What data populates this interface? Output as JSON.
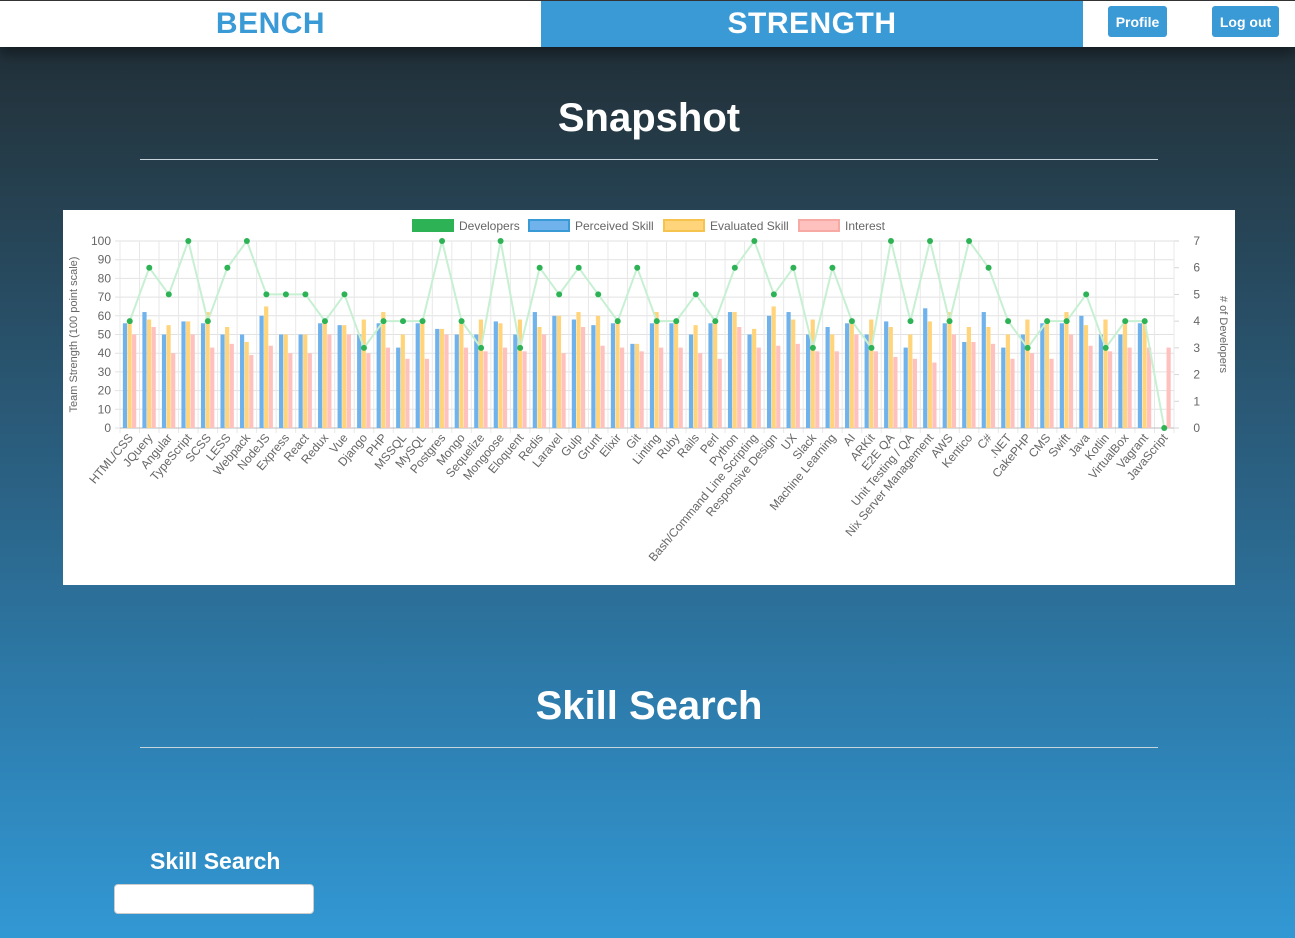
{
  "nav": {
    "bench_label": "BENCH",
    "strength_label": "STRENGTH",
    "profile_label": "Profile",
    "logout_label": "Log out"
  },
  "snapshot": {
    "title": "Snapshot"
  },
  "skill_search": {
    "section_title": "Skill Search",
    "label": "Skill Search",
    "input_value": "",
    "placeholder": ""
  },
  "colors": {
    "accent": "#3a9ad6",
    "developers": "#2db355",
    "perceived": "#6fb2ec",
    "evaluated": "#ffd47a",
    "interest": "#ffc1bd"
  },
  "chart_data": {
    "type": "bar",
    "ylabel": "Team Strength (100 point scale)",
    "y2label": "# of Developers",
    "ylim": [
      0,
      100
    ],
    "y2lim": [
      0,
      7
    ],
    "yticks": [
      0,
      10,
      20,
      30,
      40,
      50,
      60,
      70,
      80,
      90,
      100
    ],
    "y2ticks": [
      0,
      1,
      2,
      3,
      4,
      5,
      6,
      7
    ],
    "grid": true,
    "legend_position": "top",
    "categories": [
      "HTML/CSS",
      "JQuery",
      "Angular",
      "TypeScript",
      "SCSS",
      "LESS",
      "Webpack",
      "NodeJS",
      "Express",
      "React",
      "Redux",
      "Vue",
      "Django",
      "PHP",
      "MSSQL",
      "MySQL",
      "Postgres",
      "Mongo",
      "Sequelize",
      "Mongoose",
      "Eloquent",
      "Redis",
      "Laravel",
      "Gulp",
      "Grunt",
      "Elixir",
      "Git",
      "Linting",
      "Ruby",
      "Rails",
      "Perl",
      "Python",
      "Bash/Command Line Scripting",
      "Responsive Design",
      "UX",
      "Slack",
      "Machine Learning",
      "AI",
      "ARKit",
      "E2E QA",
      "Unit Testing / QA",
      "Nix Server Management",
      "AWS",
      "Kentico",
      "C#",
      ".NET",
      "CakePHP",
      "CMS",
      "Swift",
      "Java",
      "Kotlin",
      "VirtualBox",
      "Vagrant",
      "JavaScript"
    ],
    "series": [
      {
        "name": "Developers",
        "type": "line",
        "axis": "right",
        "values": [
          4,
          6,
          5,
          7,
          4,
          6,
          7,
          5,
          5,
          5,
          4,
          5,
          3,
          4,
          4,
          4,
          7,
          4,
          3,
          7,
          3,
          6,
          5,
          6,
          5,
          4,
          6,
          4,
          4,
          5,
          4,
          6,
          7,
          5,
          6,
          3,
          6,
          4,
          3,
          7,
          4,
          7,
          4,
          7,
          6,
          4,
          3,
          4,
          4,
          5,
          3,
          4,
          4,
          0
        ]
      },
      {
        "name": "Perceived Skill",
        "values": [
          56,
          62,
          50,
          57,
          56,
          50,
          50,
          60,
          50,
          50,
          56,
          55,
          50,
          56,
          43,
          56,
          53,
          50,
          50,
          57,
          50,
          62,
          60,
          58,
          55,
          56,
          45,
          56,
          56,
          50,
          56,
          62,
          50,
          60,
          62,
          50,
          54,
          56,
          50,
          57,
          43,
          64,
          56,
          46,
          62,
          43,
          50,
          56,
          56,
          60,
          50,
          50,
          56,
          0
        ]
      },
      {
        "name": "Evaluated Skill",
        "values": [
          58,
          58,
          55,
          57,
          62,
          54,
          46,
          65,
          50,
          50,
          58,
          55,
          58,
          62,
          50,
          58,
          53,
          57,
          58,
          56,
          58,
          54,
          60,
          62,
          60,
          58,
          45,
          62,
          58,
          55,
          58,
          62,
          53,
          65,
          58,
          58,
          50,
          58,
          58,
          54,
          50,
          57,
          62,
          54,
          54,
          50,
          58,
          58,
          62,
          55,
          58,
          58,
          58,
          0
        ]
      },
      {
        "name": "Interest",
        "values": [
          50,
          54,
          40,
          50,
          43,
          45,
          39,
          44,
          40,
          40,
          50,
          50,
          40,
          43,
          37,
          37,
          50,
          43,
          41,
          43,
          41,
          50,
          40,
          54,
          44,
          43,
          41,
          43,
          43,
          40,
          37,
          54,
          43,
          44,
          45,
          41,
          41,
          50,
          41,
          38,
          37,
          35,
          50,
          46,
          45,
          37,
          40,
          37,
          50,
          44,
          41,
          43,
          43,
          43
        ]
      }
    ]
  }
}
